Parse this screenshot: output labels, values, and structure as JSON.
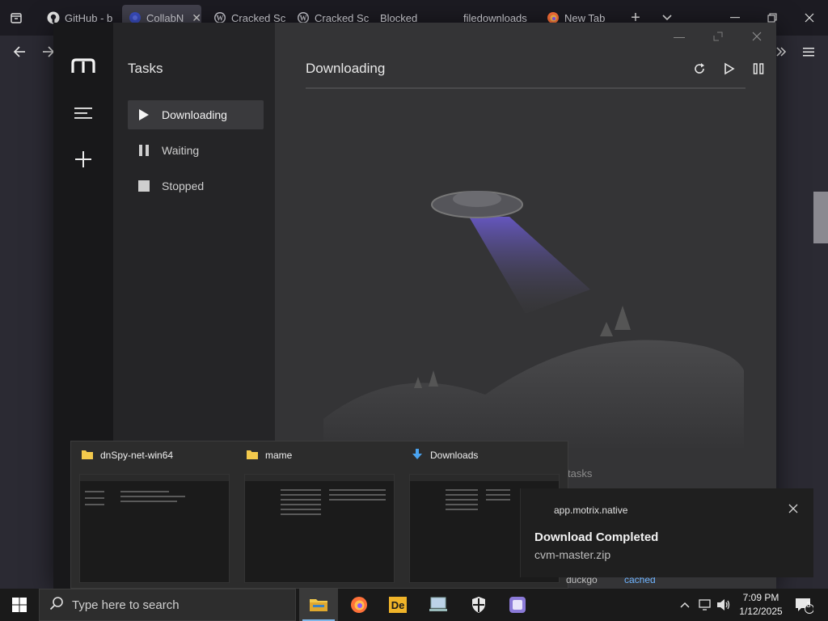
{
  "browser": {
    "tabs": [
      {
        "label": "GitHub - b",
        "icon": "github-icon",
        "active": false
      },
      {
        "label": "CollabN",
        "icon": "collab-icon",
        "active": true
      },
      {
        "label": "Cracked Sc",
        "icon": "wordpress-icon",
        "active": false
      },
      {
        "label": "Cracked Sc",
        "icon": "wordpress-icon",
        "active": false
      },
      {
        "label": "Blocked",
        "icon": "",
        "active": false
      },
      {
        "label": "filedownloads",
        "icon": "",
        "active": false
      },
      {
        "label": "New Tab",
        "icon": "firefox-icon",
        "active": false
      }
    ]
  },
  "motrix": {
    "sidebar_title": "Tasks",
    "nav": [
      {
        "label": "Downloading",
        "icon": "play-icon",
        "active": true
      },
      {
        "label": "Waiting",
        "icon": "pause-icon",
        "active": false
      },
      {
        "label": "Stopped",
        "icon": "stop-icon",
        "active": false
      }
    ],
    "main_title": "Downloading",
    "empty_text": "tasks"
  },
  "thumbnails": [
    {
      "title": "dnSpy-net-win64",
      "icon": "folder-icon"
    },
    {
      "title": "mame",
      "icon": "folder-icon"
    },
    {
      "title": "Downloads",
      "icon": "download-folder-icon"
    }
  ],
  "toast": {
    "app": "app.motrix.native",
    "title": "Download Completed",
    "body": "cvm-master.zip"
  },
  "under_toast": {
    "left": "duckgo",
    "right": "cached"
  },
  "taskbar": {
    "search_placeholder": "Type here to search",
    "time": "7:09 PM",
    "date": "1/12/2025",
    "notification_count": "3"
  },
  "colors": {
    "accent": "#7fb6e8",
    "motrix_sidebar": "#18181a",
    "motrix_main": "#343436",
    "ufo_beam": "#6a5acd"
  }
}
